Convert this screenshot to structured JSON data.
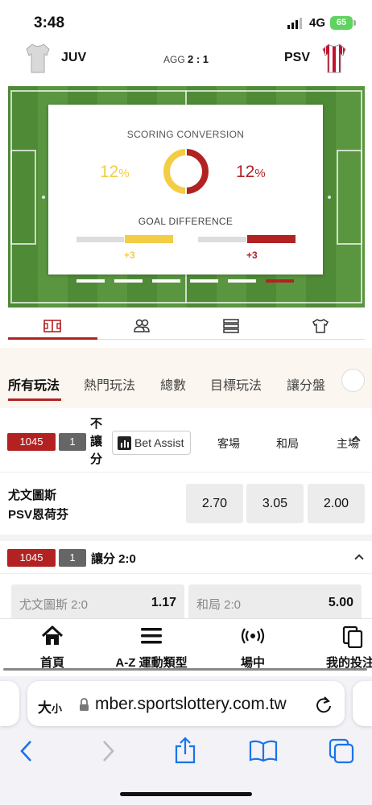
{
  "status": {
    "time": "3:48",
    "network": "4G",
    "battery": "65"
  },
  "match": {
    "home_name": "JUV",
    "away_name": "PSV",
    "agg_label": "AGG",
    "agg_score": "2 : 1"
  },
  "stats": {
    "scoring_title": "SCORING CONVERSION",
    "left_pct": "12",
    "right_pct": "12",
    "pct_unit": "%",
    "goal_diff_title": "GOAL DIFFERENCE",
    "left_gd": "+3",
    "right_gd": "+3",
    "colors": {
      "home": "#f2cd45",
      "away": "#b22222"
    }
  },
  "view_tabs": [
    "pitch-icon",
    "players-icon",
    "list-icon",
    "shirt-icon"
  ],
  "filter_tabs": [
    "所有玩法",
    "熱門玩法",
    "總數",
    "目標玩法",
    "讓分盤"
  ],
  "market1": {
    "id": "1045",
    "num": "1",
    "type": "不讓分",
    "bet_assist": "Bet Assist",
    "col_away": "客場",
    "col_draw": "和局",
    "col_home": "主場",
    "team_a": "尤文圖斯",
    "team_b": "PSV恩荷芬",
    "odds": [
      "2.70",
      "3.05",
      "2.00"
    ]
  },
  "market2": {
    "id": "1045",
    "num": "1",
    "label": "讓分 2:0",
    "selections": [
      {
        "name": "尤文圖斯 2:0",
        "odd": "1.17"
      },
      {
        "name": "和局 2:0",
        "odd": "5.00"
      }
    ]
  },
  "bottom_nav": [
    {
      "label": "首頁",
      "icon": "home-icon"
    },
    {
      "label": "A-Z 運動類型",
      "icon": "menu-icon"
    },
    {
      "label": "場中",
      "icon": "live-icon"
    },
    {
      "label": "我的投注",
      "icon": "bets-icon"
    }
  ],
  "browser": {
    "aa_big": "大",
    "aa_small": "小",
    "url": "mber.sportslottery.com.tw"
  }
}
